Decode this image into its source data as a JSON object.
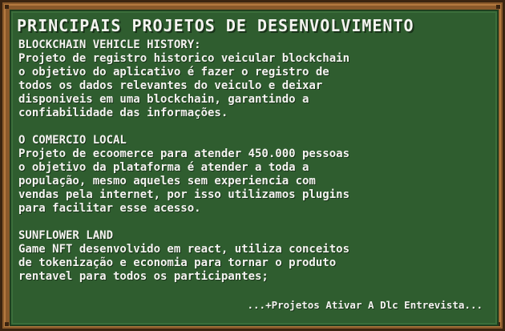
{
  "board": {
    "title": "PRINCIPAIS PROJETOS DE DESENVOLVIMENTO"
  },
  "projects": [
    {
      "name": "BLOCKCHAIN VEHICLE HISTORY:",
      "description": "Projeto de registro historico veicular blockchain\no objetivo do aplicativo é fazer o registro de\ntodos os dados relevantes do veiculo e deixar\ndisponiveis em uma blockchain, garantindo a\nconfiabilidade das informações."
    },
    {
      "name": "O COMERCIO LOCAL",
      "description": "Projeto de ecoomerce para atender 450.000 pessoas\no objetivo da plataforma é atender a toda a\npopulação, mesmo aqueles sem experiencia com\nvendas pela internet, por isso utilizamos plugins\npara facilitar esse acesso."
    },
    {
      "name": "SUNFLOWER LAND",
      "description": "Game NFT desenvolvido em react, utiliza conceitos\nde tokenização e economia para tornar o produto\nrentavel para todos os participantes;"
    }
  ],
  "footer": {
    "text": "...+Projetos Ativar A Dlc Entrevista..."
  },
  "colors": {
    "board": "#2f5d2f",
    "frame": "#8b5a2b",
    "text": "#f4f4f0"
  }
}
